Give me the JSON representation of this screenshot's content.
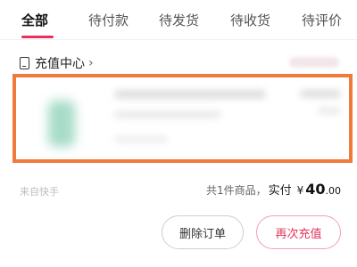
{
  "tabs": [
    {
      "label": "全部",
      "active": true
    },
    {
      "label": "待付款",
      "active": false
    },
    {
      "label": "待发货",
      "active": false
    },
    {
      "label": "待收货",
      "active": false
    },
    {
      "label": "待评价",
      "active": false
    }
  ],
  "order": {
    "store_name": "充值中心",
    "store_icon": "phone-icon",
    "footer_note": "来自快手",
    "summary": {
      "count_text": "共1件商品，",
      "paid_label": "实付",
      "currency": "¥",
      "amount_int": "40",
      "amount_dec": ".00"
    },
    "buttons": {
      "delete": "删除订单",
      "recharge": "再次充值"
    }
  },
  "colors": {
    "accent": "#e1335c",
    "highlight_border": "#f07a3a"
  }
}
